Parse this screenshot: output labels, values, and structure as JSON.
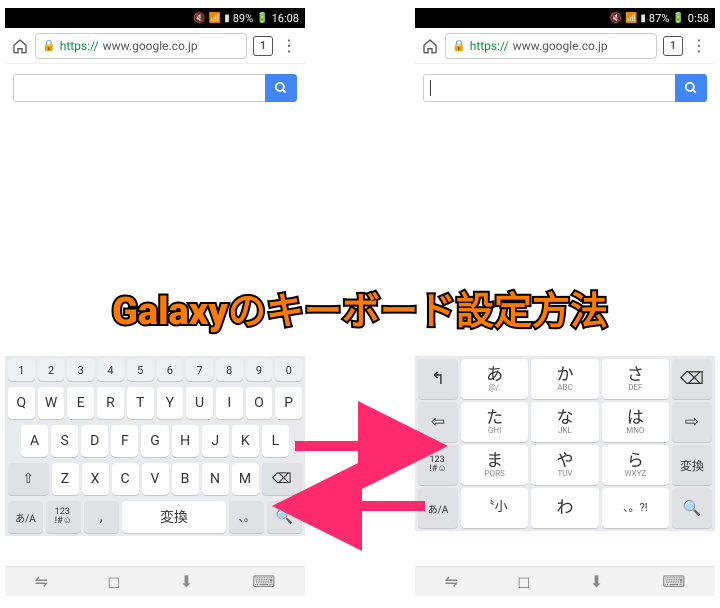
{
  "overlay_title": "Galaxyのキーボード設定方法",
  "left": {
    "status": {
      "battery": "89%",
      "time": "16:08"
    },
    "url": {
      "https": "https://",
      "host": "www.google.co.jp"
    },
    "tabs": "1",
    "qwerty": {
      "num_row": [
        "1",
        "2",
        "3",
        "4",
        "5",
        "6",
        "7",
        "8",
        "9",
        "0"
      ],
      "r1": [
        "Q",
        "W",
        "E",
        "R",
        "T",
        "Y",
        "U",
        "I",
        "O",
        "P"
      ],
      "r2": [
        "A",
        "S",
        "D",
        "F",
        "G",
        "H",
        "J",
        "K",
        "L"
      ],
      "r3_shift": "⇧",
      "r3": [
        "Z",
        "X",
        "C",
        "V",
        "B",
        "N",
        "M"
      ],
      "r3_del": "⌫",
      "r4_lang": "あ/A",
      "r4_sym": "123\n!#☺",
      "r4_comma": ",",
      "r4_space": "変換",
      "r4_dot": "、。",
      "r4_search": "🔍"
    }
  },
  "right": {
    "status": {
      "battery": "87%",
      "time": "0:58"
    },
    "url": {
      "https": "https://",
      "host": "www.google.co.jp"
    },
    "tabs": "1",
    "tenkey": {
      "rows": [
        {
          "side_l": "↰",
          "c1": {
            "m": "あ",
            "s": "@/:"
          },
          "c2": {
            "m": "か",
            "s": "ABC"
          },
          "c3": {
            "m": "さ",
            "s": "DEF"
          },
          "side_r": "⌫"
        },
        {
          "side_l": "⇦",
          "c1": {
            "m": "た",
            "s": "GHI"
          },
          "c2": {
            "m": "な",
            "s": "JKL"
          },
          "c3": {
            "m": "は",
            "s": "MNO"
          },
          "side_r": "⇨"
        },
        {
          "side_l": "123\n!#☺",
          "c1": {
            "m": "ま",
            "s": "PQRS"
          },
          "c2": {
            "m": "や",
            "s": "TUV"
          },
          "c3": {
            "m": "ら",
            "s": "WXYZ"
          },
          "side_r": "変換"
        },
        {
          "side_l": "あ/A",
          "c1": {
            "m": "〝小",
            "s": ""
          },
          "c2": {
            "m": "わ",
            "s": ""
          },
          "c3": {
            "m": "、。?!",
            "s": ""
          },
          "side_r": "🔍"
        }
      ]
    }
  },
  "nav_icons": [
    "⇋",
    "◻",
    "⬇",
    "⌨"
  ]
}
